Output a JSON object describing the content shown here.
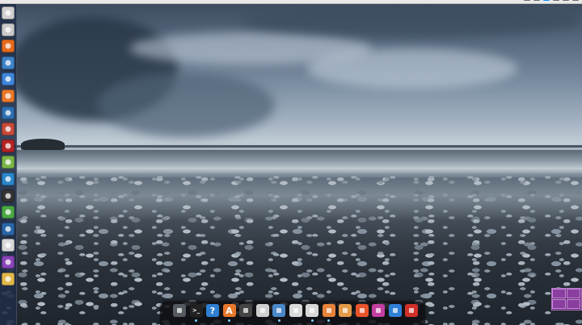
{
  "screen": {
    "description_free": true
  },
  "top_panel": {
    "tray_icons": [
      "network-icon",
      "volume-icon",
      "indicator-icon",
      "battery-icon",
      "clock-icon",
      "session-icon"
    ]
  },
  "launcher": {
    "items": [
      {
        "name": "dash-icon",
        "color": "#d0d0d0"
      },
      {
        "name": "files-icon",
        "color": "#c9c9c9"
      },
      {
        "name": "firefox-icon",
        "color": "#e66a1c"
      },
      {
        "name": "chromium-icon",
        "color": "#3e83c9"
      },
      {
        "name": "writer-icon",
        "color": "#3f86d9"
      },
      {
        "name": "software-center-icon",
        "color": "#e8782a"
      },
      {
        "name": "shotwell-icon",
        "color": "#2d6fb1"
      },
      {
        "name": "system-tools-icon",
        "color": "#c84a3a"
      },
      {
        "name": "terminal-icon",
        "color": "#b52424"
      },
      {
        "name": "settings-icon",
        "color": "#7ab648"
      },
      {
        "name": "skype-icon",
        "color": "#2a86c9"
      },
      {
        "name": "sublime-icon",
        "color": "#333333"
      },
      {
        "name": "torrent-icon",
        "color": "#4aa843"
      },
      {
        "name": "network-tool-icon",
        "color": "#2866a8"
      },
      {
        "name": "slides-icon",
        "color": "#d8d8d8"
      },
      {
        "name": "media-icon",
        "color": "#8a44b8"
      },
      {
        "name": "archive-icon",
        "color": "#e1b74a"
      }
    ]
  },
  "dock": {
    "items": [
      {
        "name": "wheel-icon",
        "color": "#555a60",
        "glyph": ""
      },
      {
        "name": "terminal-icon",
        "color": "#222222",
        "glyph": ">_"
      },
      {
        "name": "help-icon",
        "color": "#2f7fd3",
        "glyph": "?"
      },
      {
        "name": "software-center-icon",
        "color": "#e8782a",
        "glyph": "A"
      },
      {
        "name": "camera-icon",
        "color": "#444444",
        "glyph": ""
      },
      {
        "name": "calculator-icon",
        "color": "#cfcfcf",
        "glyph": ""
      },
      {
        "name": "browser-icon",
        "color": "#4a88c8",
        "glyph": ""
      },
      {
        "name": "window-icon",
        "color": "#d9d9d9",
        "glyph": ""
      },
      {
        "name": "control-panel-icon",
        "color": "#d7d7d7",
        "glyph": ""
      },
      {
        "name": "folder-icon",
        "color": "#e6823a",
        "glyph": ""
      },
      {
        "name": "document-icon",
        "color": "#e39a49",
        "glyph": ""
      },
      {
        "name": "clock-icon",
        "color": "#e8532a",
        "glyph": ""
      },
      {
        "name": "media-icon",
        "color": "#c23fa0",
        "glyph": ""
      },
      {
        "name": "accessibility-icon",
        "color": "#2e7fd6",
        "glyph": ""
      },
      {
        "name": "power-icon",
        "color": "#d0302a",
        "glyph": ""
      }
    ]
  },
  "workspace_switcher": {
    "color": "#8a3fa0"
  }
}
